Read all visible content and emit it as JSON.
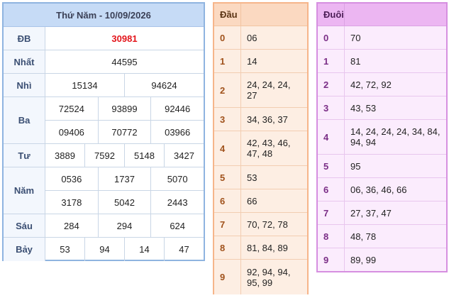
{
  "result": {
    "title": "Thứ Năm - 10/09/2026",
    "rows": [
      {
        "label": "ĐB",
        "lines": [
          [
            "30981"
          ]
        ],
        "highlight": true
      },
      {
        "label": "Nhất",
        "lines": [
          [
            "44595"
          ]
        ]
      },
      {
        "label": "Nhì",
        "lines": [
          [
            "15134",
            "94624"
          ]
        ]
      },
      {
        "label": "Ba",
        "lines": [
          [
            "72524",
            "93899",
            "92446"
          ],
          [
            "09406",
            "70772",
            "03966"
          ]
        ]
      },
      {
        "label": "Tư",
        "lines": [
          [
            "3889",
            "7592",
            "5148",
            "3427"
          ]
        ]
      },
      {
        "label": "Năm",
        "lines": [
          [
            "0536",
            "1737",
            "5070"
          ],
          [
            "3178",
            "5042",
            "2443"
          ]
        ]
      },
      {
        "label": "Sáu",
        "lines": [
          [
            "284",
            "294",
            "624"
          ]
        ]
      },
      {
        "label": "Bảy",
        "lines": [
          [
            "53",
            "94",
            "14",
            "47"
          ]
        ]
      }
    ]
  },
  "dau": {
    "header": "Đầu",
    "rows": [
      {
        "digit": "0",
        "values": "06"
      },
      {
        "digit": "1",
        "values": "14"
      },
      {
        "digit": "2",
        "values": "24, 24, 24, 27"
      },
      {
        "digit": "3",
        "values": "34, 36, 37"
      },
      {
        "digit": "4",
        "values": "42, 43, 46, 47, 48"
      },
      {
        "digit": "5",
        "values": "53"
      },
      {
        "digit": "6",
        "values": "66"
      },
      {
        "digit": "7",
        "values": "70, 72, 78"
      },
      {
        "digit": "8",
        "values": "81, 84, 89"
      },
      {
        "digit": "9",
        "values": "92, 94, 94, 95, 99"
      }
    ]
  },
  "duoi": {
    "header": "Đuôi",
    "rows": [
      {
        "digit": "0",
        "values": "70"
      },
      {
        "digit": "1",
        "values": "81"
      },
      {
        "digit": "2",
        "values": "42, 72, 92"
      },
      {
        "digit": "3",
        "values": "43, 53"
      },
      {
        "digit": "4",
        "values": "14, 24, 24, 24, 34, 84, 94, 94"
      },
      {
        "digit": "5",
        "values": "95"
      },
      {
        "digit": "6",
        "values": "06, 36, 46, 66"
      },
      {
        "digit": "7",
        "values": "27, 37, 47"
      },
      {
        "digit": "8",
        "values": "48, 78"
      },
      {
        "digit": "9",
        "values": "89, 99"
      }
    ]
  },
  "colors": {
    "special_prize": "#e3151b",
    "result_header": "#c6dbf6",
    "dau_header": "#fbd9c1",
    "dau_body": "#fdeee3",
    "duoi_header": "#ecb6f2",
    "duoi_body": "#fbecfd"
  }
}
